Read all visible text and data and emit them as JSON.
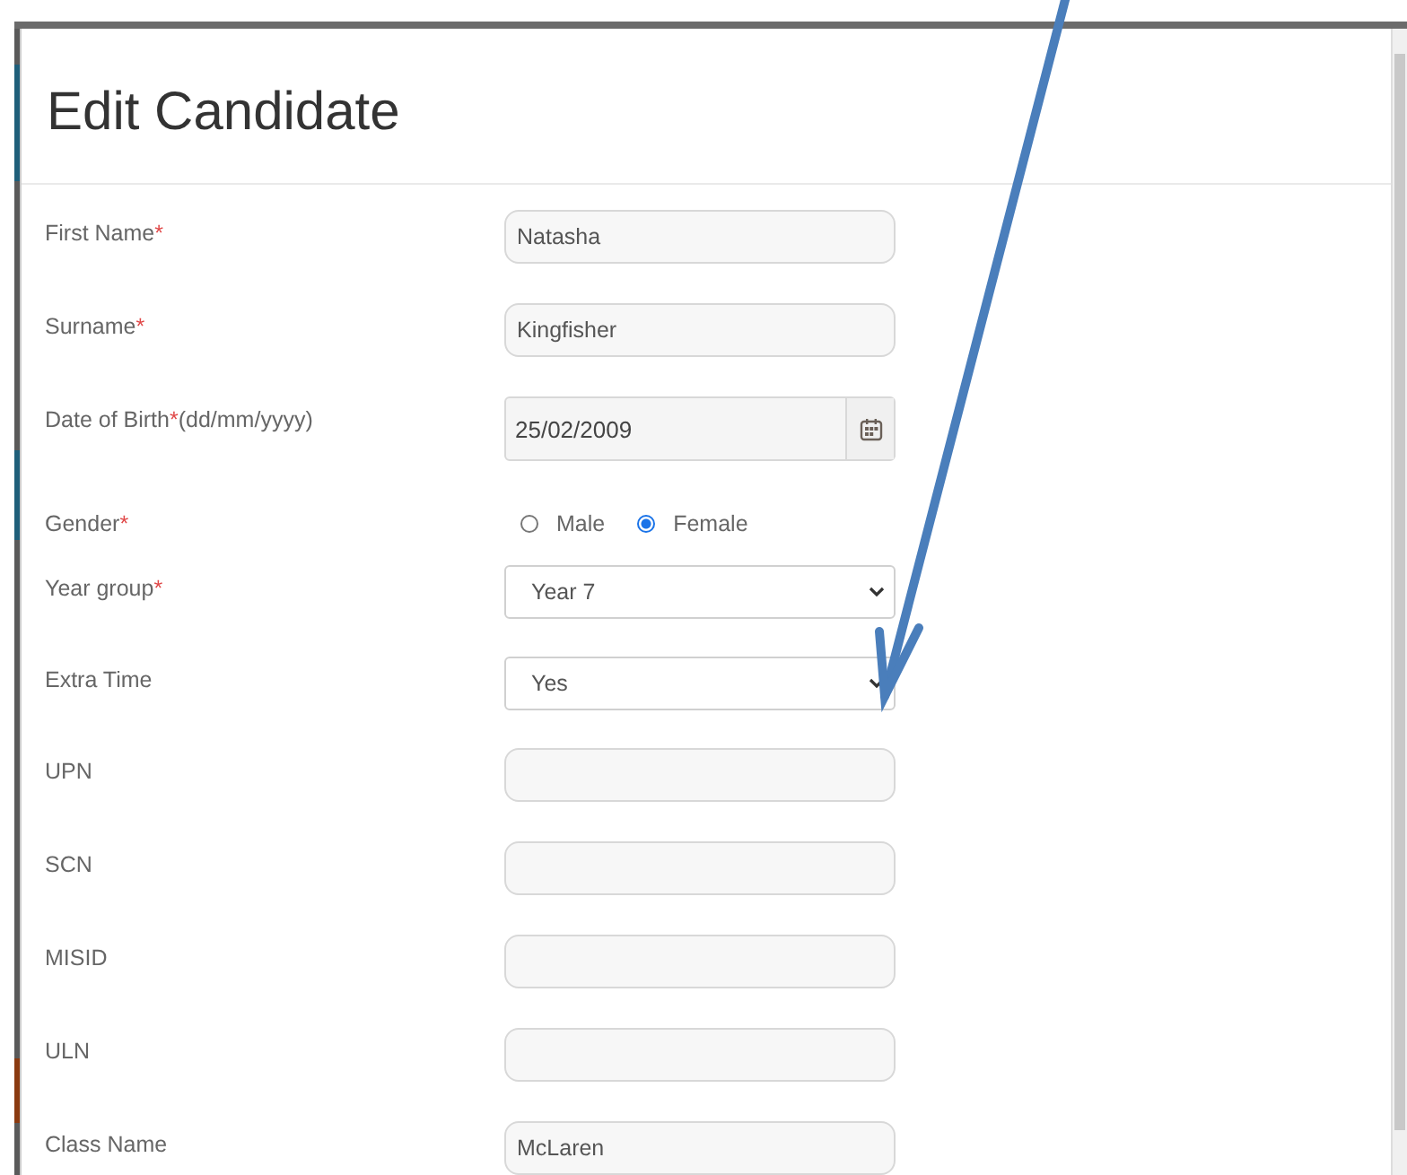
{
  "dialog": {
    "title": "Edit Candidate"
  },
  "fields": [
    {
      "kind": "text",
      "label": "First Name",
      "marker": "*",
      "value": "Natasha"
    },
    {
      "kind": "text",
      "label": "Surname",
      "marker": "*",
      "value": "Kingfisher"
    },
    {
      "kind": "date",
      "label": "Date of Birth",
      "marker": "*",
      "hint": "(dd/mm/yyyy)",
      "value": "25/02/2009"
    },
    {
      "kind": "radio",
      "label": "Gender",
      "marker": "*",
      "options": [
        {
          "label": "Male",
          "selected": false
        },
        {
          "label": "Female",
          "selected": true
        }
      ]
    },
    {
      "kind": "select",
      "label": "Year group",
      "marker": "*",
      "value": "Year 7"
    },
    {
      "kind": "select",
      "label": "Extra Time",
      "value": "Yes"
    },
    {
      "kind": "text",
      "label": "UPN"
    },
    {
      "kind": "text",
      "label": "SCN"
    },
    {
      "kind": "text",
      "label": "MISID"
    },
    {
      "kind": "text",
      "label": "ULN"
    },
    {
      "kind": "text",
      "label": "Class Name",
      "value": "McLaren"
    }
  ]
}
